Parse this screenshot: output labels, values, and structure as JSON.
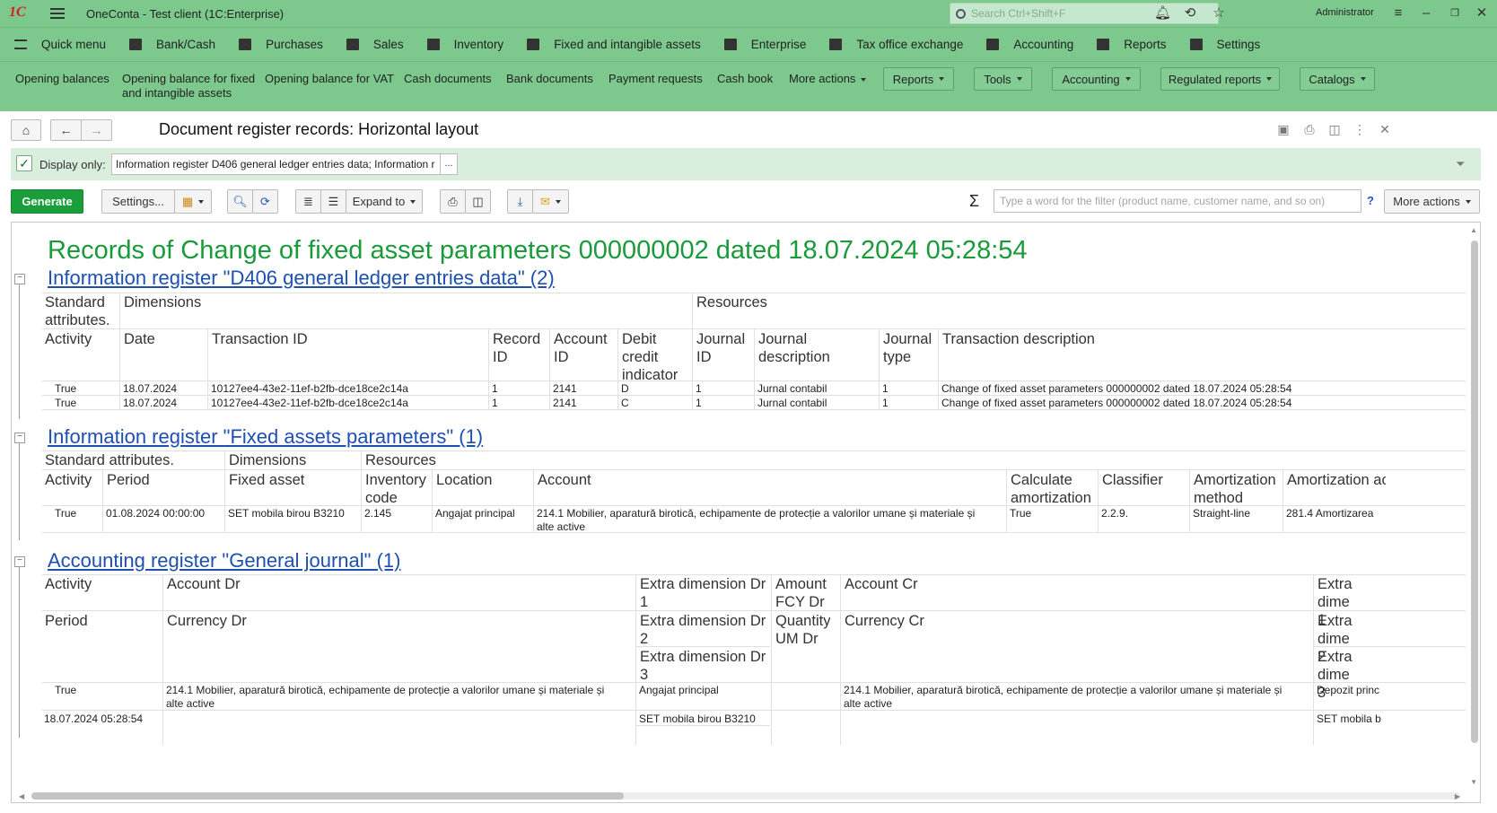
{
  "titlebar": {
    "logo": "1С",
    "title": "OneConta  - Test client (1C:Enterprise)",
    "search_placeholder": "Search Ctrl+Shift+F",
    "user": "Administrator"
  },
  "mainmenu": [
    "Quick menu",
    "Bank/Cash",
    "Purchases",
    "Sales",
    "Inventory",
    "Fixed and intangible assets",
    "Enterprise",
    "Tax office exchange",
    "Accounting",
    "Reports",
    "Settings"
  ],
  "sectionpanel": {
    "links": [
      "Opening balances",
      "Opening balance for fixed\nand intangible assets",
      "Opening balance for VAT",
      "Cash documents",
      "Bank documents",
      "Payment requests",
      "Cash book",
      "More actions"
    ],
    "buttons": [
      "Reports",
      "Tools",
      "Accounting",
      "Regulated reports",
      "Catalogs"
    ]
  },
  "form": {
    "title": "Document register records: Horizontal layout",
    "display_only_label": "Display only:",
    "display_only_value": "Information register D406 general ledger entries data; Information r",
    "display_only_dots": "...",
    "display_only_checked": "✓"
  },
  "toolbar": {
    "generate": "Generate",
    "settings": "Settings...",
    "expand_to": "Expand to",
    "sigma": "Σ",
    "filter_placeholder": "Type a word for the filter (product name, customer name, and so on)",
    "help": "?",
    "more_actions": "More actions"
  },
  "report": {
    "title": "Records of Change of fixed asset parameters 000000002 dated 18.07.2024 05:28:54",
    "group1": {
      "title": "Information register \"D406 general ledger entries data\" (2)",
      "header_top": [
        "Standard\nattributes.",
        "Dimensions",
        "Resources"
      ],
      "headers": [
        "Activity",
        "Date",
        "Transaction ID",
        "Record\nID",
        "Account\nID",
        "Debit\ncredit\nindicator",
        "Journal\nID",
        "Journal\ndescription",
        "Journal\ntype",
        "Transaction description"
      ],
      "rows": [
        [
          "True",
          "18.07.2024",
          "10127ee4-43e2-11ef-b2fb-dce18ce2c14a",
          "1",
          "2141",
          "D",
          "1",
          "Jurnal contabil",
          "1",
          "Change of fixed asset parameters 000000002 dated 18.07.2024 05:28:54"
        ],
        [
          "True",
          "18.07.2024",
          "10127ee4-43e2-11ef-b2fb-dce18ce2c14a",
          "1",
          "2141",
          "C",
          "1",
          "Jurnal contabil",
          "1",
          "Change of fixed asset parameters 000000002 dated 18.07.2024 05:28:54"
        ]
      ]
    },
    "group2": {
      "title": "Information register \"Fixed assets parameters\" (1)",
      "header_top": [
        "Standard attributes.",
        "Dimensions",
        "Resources"
      ],
      "headers": [
        "Activity",
        "Period",
        "Fixed asset",
        "Inventory\ncode",
        "Location",
        "Account",
        "Calculate\namortization",
        "Classifier",
        "Amortization\nmethod",
        "Amortization ac"
      ],
      "rows": [
        [
          "True",
          "01.08.2024 00:00:00",
          "SET mobila birou B3210",
          "2.145",
          "Angajat principal",
          "214.1  Mobilier, aparatură birotică, echipamente de protecție a valorilor umane și materiale și\nalte active",
          "True",
          "2.2.9.",
          "Straight-line",
          "281.4  Amortizarea"
        ]
      ]
    },
    "group3": {
      "title": "Accounting register \"General journal\" (1)",
      "headers_row1": [
        "Activity",
        "Account Dr",
        "Extra dimension Dr\n1",
        "Amount\nFCY Dr",
        "Account Cr",
        "Extra dime\n1"
      ],
      "headers_row2": [
        "Period",
        "Currency Dr",
        "Extra dimension Dr\n2",
        "Quantity\nUM Dr",
        "Currency Cr",
        "Extra dime\n2"
      ],
      "headers_row3": [
        "Extra dimension Dr\n3",
        "Extra dime\n3"
      ],
      "row1": [
        "True",
        "214.1  Mobilier, aparatură birotică, echipamente de protecție a valorilor umane și materiale și\nalte active",
        "Angajat principal",
        "214.1  Mobilier, aparatură birotică, echipamente de protecție a valorilor umane și materiale și\nalte active",
        "Depozit princ"
      ],
      "row2": [
        "18.07.2024 05:28:54",
        "SET mobila birou B3210",
        "SET mobila b"
      ]
    }
  }
}
